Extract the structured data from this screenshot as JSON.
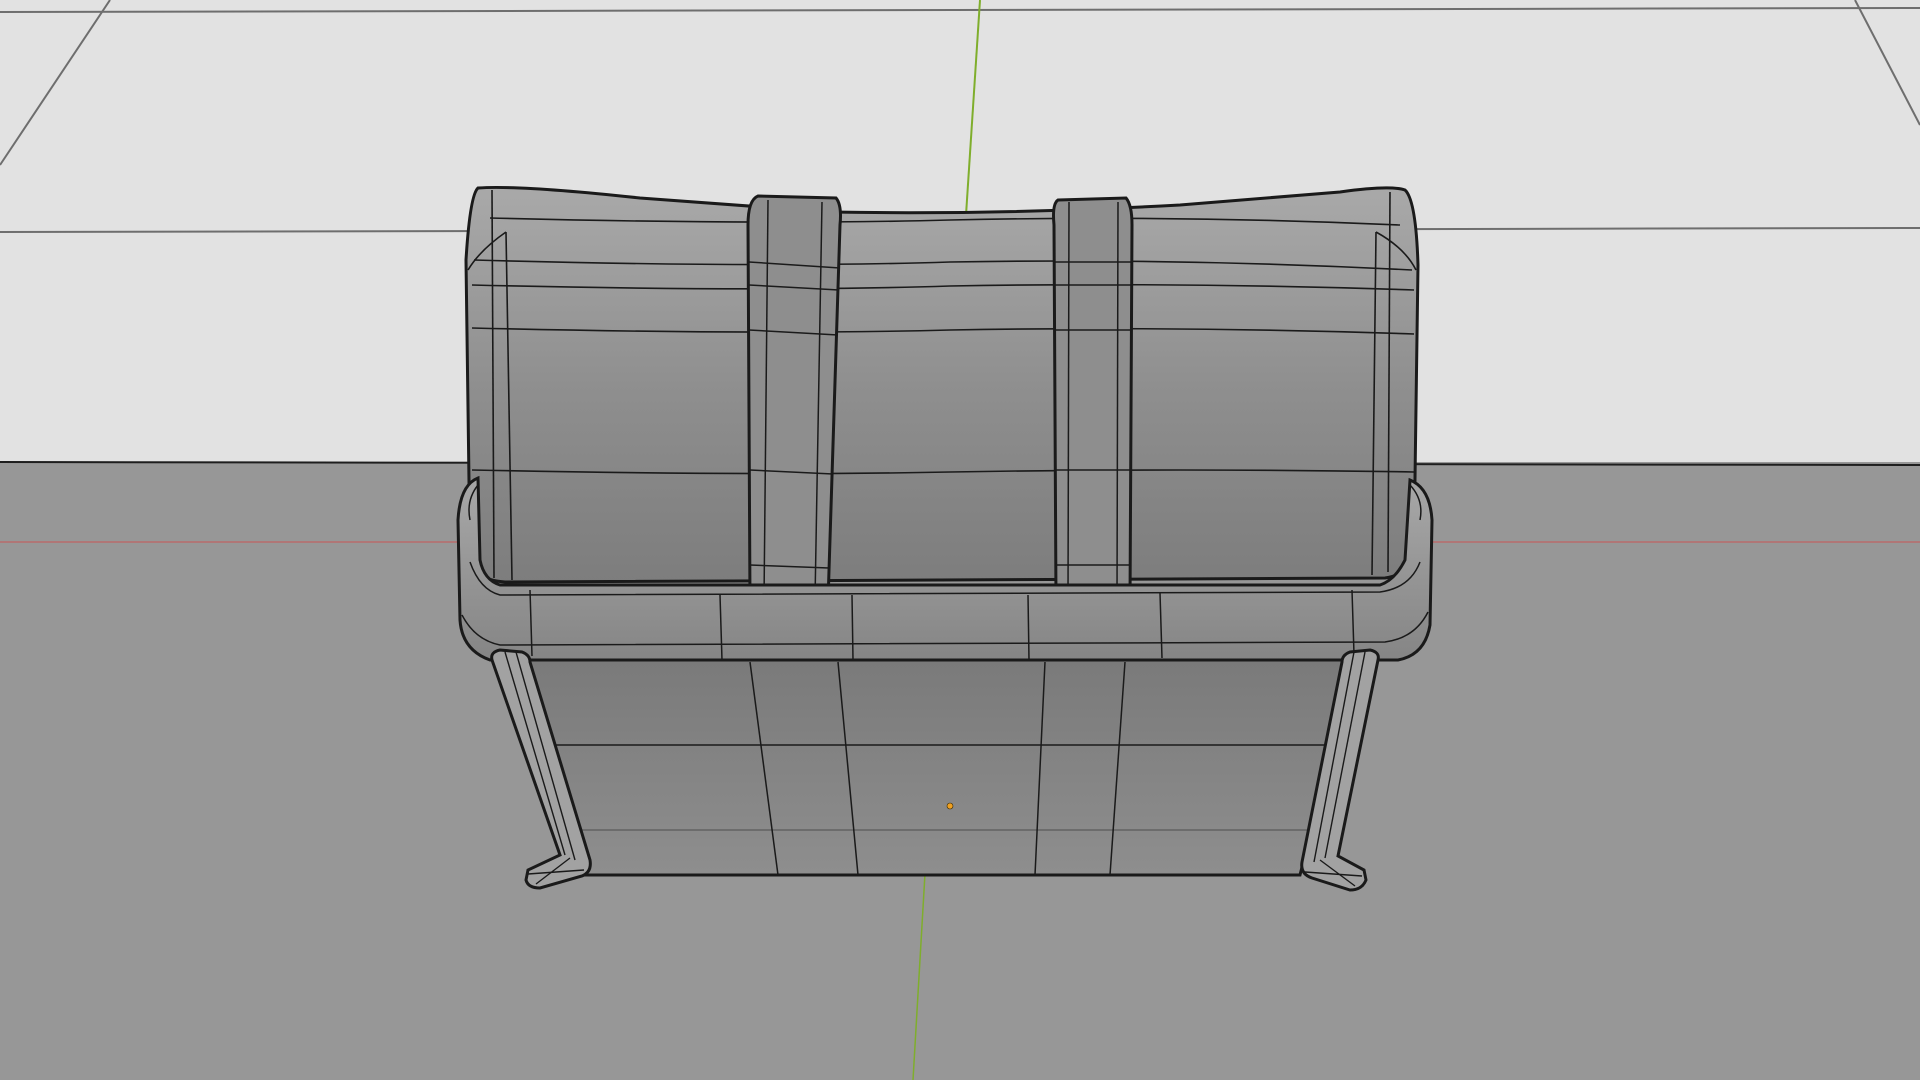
{
  "viewport": {
    "label": "",
    "colors": {
      "background_far": "#e2e2e2",
      "background_near": "#979797",
      "grid_line": "#6e6e6e",
      "horizon_line": "#1e1e1e",
      "x_axis": "#b86b6b",
      "y_axis": "#7fae2c",
      "model_fill_top": "#a4a4a4",
      "model_fill": "#8c8c8c",
      "model_fill_dark": "#747474",
      "wire_edge": "#1a1a1a",
      "origin_point": "#f0a020"
    },
    "object": {
      "name": "",
      "parts": [
        "lid",
        "strap-left",
        "strap-right",
        "rim",
        "base",
        "leg-left",
        "leg-right"
      ]
    }
  }
}
